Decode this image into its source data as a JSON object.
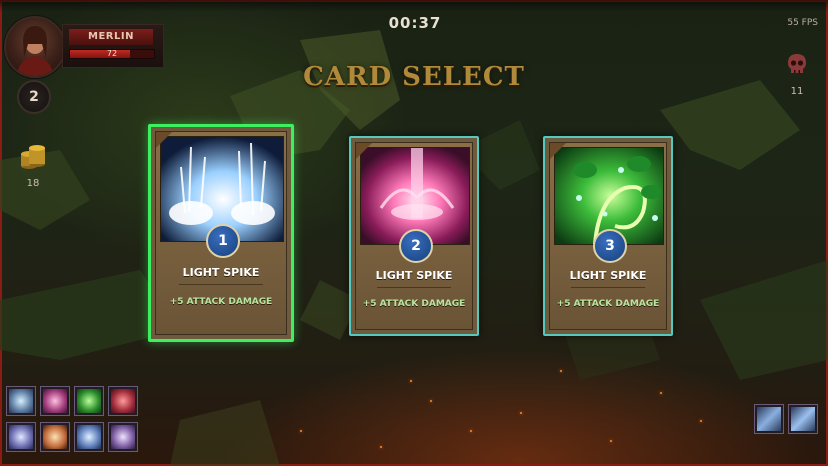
{
  "hud": {
    "timer": "00:37",
    "fps": "55 FPS",
    "player_name": "MERLIN",
    "hp_value": "72",
    "hp_fraction": 0.72,
    "level": "2",
    "gold": "18",
    "kills": "11",
    "icons": {
      "portrait": "player-portrait",
      "gold": "gold-coins-icon",
      "kills": "skull-icon"
    }
  },
  "screen": {
    "title": "CARD SELECT"
  },
  "cards": [
    {
      "number": "1",
      "name": "LIGHT SPIKE",
      "desc": "+5 ATTACK DAMAGE",
      "selected": true,
      "art": "lightning-spikes"
    },
    {
      "number": "2",
      "name": "LIGHT SPIKE",
      "desc": "+5 ATTACK DAMAGE",
      "selected": false,
      "art": "pink-energy-burst"
    },
    {
      "number": "3",
      "name": "LIGHT SPIKE",
      "desc": "+5 ATTACK DAMAGE",
      "selected": false,
      "art": "green-vine-magic"
    }
  ],
  "skills": {
    "row1": [
      "frost-skill-icon",
      "pink-orb-skill-icon",
      "green-leaf-skill-icon",
      "red-spiral-skill-icon"
    ],
    "row2": [
      "ice-shard-skill-icon",
      "fire-burst-skill-icon",
      "wind-slash-skill-icon",
      "blade-skill-icon"
    ],
    "passive": [
      "passive-slot-icon",
      "passive-slot-icon"
    ]
  },
  "colors": {
    "selected_border": "#3cf060",
    "card_border": "#55c8c0",
    "title": "#b08a3a",
    "frame": "#8a1c14"
  }
}
